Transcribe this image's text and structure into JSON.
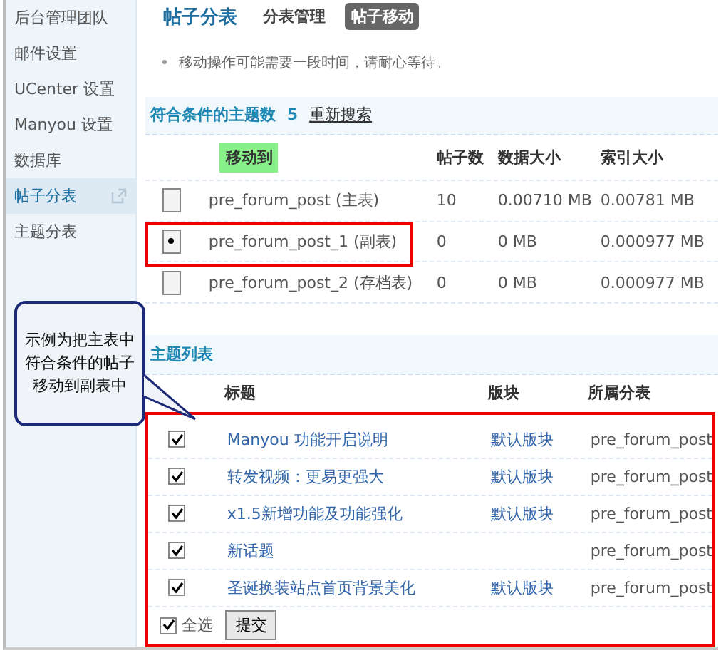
{
  "sidebar": {
    "items": [
      {
        "label": "后台管理团队",
        "selected": false
      },
      {
        "label": "邮件设置",
        "selected": false
      },
      {
        "label": "UCenter 设置",
        "selected": false
      },
      {
        "label": "Manyou 设置",
        "selected": false
      },
      {
        "label": "数据库",
        "selected": false
      },
      {
        "label": "帖子分表",
        "selected": true
      },
      {
        "label": "主题分表",
        "selected": false
      }
    ]
  },
  "header": {
    "title": "帖子分表",
    "tabs": [
      {
        "label": "分表管理",
        "selected": false
      },
      {
        "label": "帖子移动",
        "selected": true
      }
    ]
  },
  "notice": "移动操作可能需要一段时间，请耐心等待。",
  "match_bar": {
    "label": "符合条件的主题数",
    "count": "5",
    "link": "重新搜索"
  },
  "move_table": {
    "columns": [
      "移动到",
      "帖子数",
      "数据大小",
      "索引大小"
    ],
    "rows": [
      {
        "name": "pre_forum_post (主表)",
        "posts": "10",
        "data_size": "0.00710 MB",
        "index_size": "0.00781 MB",
        "selected": false,
        "highlighted": false
      },
      {
        "name": "pre_forum_post_1 (副表)",
        "posts": "0",
        "data_size": "0 MB",
        "index_size": "0.000977 MB",
        "selected": true,
        "highlighted": true
      },
      {
        "name": "pre_forum_post_2 (存档表)",
        "posts": "0",
        "data_size": "0 MB",
        "index_size": "0.000977 MB",
        "selected": false,
        "highlighted": false
      }
    ]
  },
  "topic_list": {
    "title": "主题列表",
    "columns": [
      "标题",
      "版块",
      "所属分表"
    ],
    "highlighted": true,
    "rows": [
      {
        "title": "Manyou 功能开启说明",
        "forum": "默认版块",
        "table": "pre_forum_post",
        "checked": true
      },
      {
        "title": "转发视频：更易更强大",
        "forum": "默认版块",
        "table": "pre_forum_post",
        "checked": true
      },
      {
        "title": "x1.5新增功能及功能强化",
        "forum": "默认版块",
        "table": "pre_forum_post",
        "checked": true
      },
      {
        "title": "新话题",
        "table": "pre_forum_post",
        "checked": true
      },
      {
        "title": "圣诞换装站点首页背景美化",
        "forum": "默认版块",
        "table": "pre_forum_post",
        "checked": true
      }
    ],
    "select_all": {
      "label": "全选",
      "checked": true
    },
    "submit": "提交"
  },
  "callout": {
    "lines": [
      "示例为把主表中",
      "符合条件的帖子",
      "移动到副表中"
    ]
  }
}
